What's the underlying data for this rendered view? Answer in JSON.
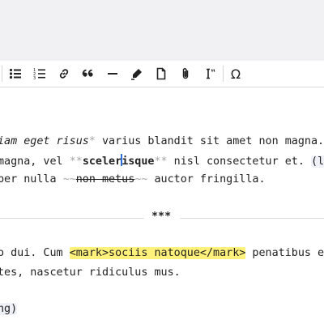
{
  "toolbar": {
    "buttons": [
      {
        "name": "bulleted-list-icon"
      },
      {
        "name": "numbered-list-icon"
      },
      {
        "name": "link-icon"
      },
      {
        "name": "quote-icon"
      },
      {
        "name": "horizontal-rule-icon"
      },
      {
        "name": "highlighter-icon"
      },
      {
        "name": "document-icon"
      },
      {
        "name": "attachment-icon"
      },
      {
        "name": "clear-formatting-icon"
      },
      {
        "name": "special-character-icon",
        "glyph": "Ω"
      }
    ]
  },
  "editor": {
    "line1": {
      "italic": "iam eget risus",
      "marker": "*",
      "rest": " varius blandit sit amet non magna."
    },
    "line2": {
      "pre": "magna, vel ",
      "marker_open": "**",
      "bold_a": "sceler",
      "bold_b": "isque",
      "marker_close": "**",
      "mid": " nisl consectetur et. ",
      "paren": "(li"
    },
    "line3": {
      "pre": "per nulla ",
      "marker_open": "~~",
      "strike": "non metus",
      "marker_close": "~~",
      "rest": " auctor fringilla."
    },
    "hr": "***",
    "line4": {
      "pre": "o dui. Cum ",
      "mark": "<mark>sociis natoque</mark>",
      "rest": " penatibus et"
    },
    "line5": "tes, nascetur ridiculus mus.",
    "line6": "ng)"
  },
  "colors": {
    "caret": "#2a6fdb",
    "mark_highlight": "#fff17a",
    "markdown_marker": "#a6a6a6"
  }
}
